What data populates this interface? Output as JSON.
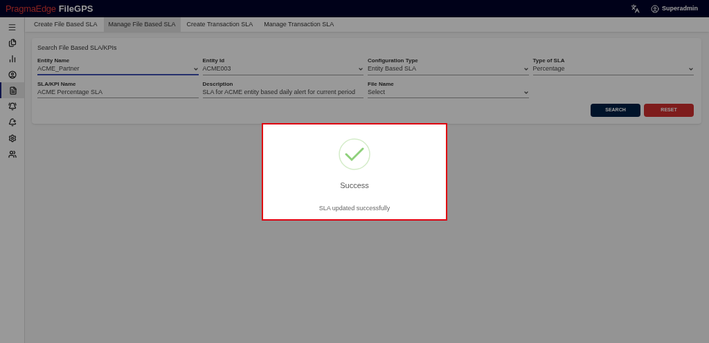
{
  "header": {
    "brand": "PragmaEdge",
    "product": "FileGPS",
    "user": "Superadmin"
  },
  "sidebar": {
    "items": [
      {
        "selected": false
      },
      {
        "selected": false
      },
      {
        "selected": false
      },
      {
        "selected": true
      },
      {
        "selected": false
      },
      {
        "selected": false
      },
      {
        "selected": false
      },
      {
        "selected": false
      }
    ]
  },
  "tabs": [
    {
      "label": "Create File Based SLA",
      "selected": false
    },
    {
      "label": "Manage File Based SLA",
      "selected": true
    },
    {
      "label": "Create Transaction SLA",
      "selected": false
    },
    {
      "label": "Manage Transaction SLA",
      "selected": false
    }
  ],
  "search_card": {
    "title": "Search File Based SLA/KPIs",
    "rows": [
      [
        {
          "label": "Entity Name",
          "value": "ACME_Partner",
          "kind": "select",
          "focused": true
        },
        {
          "label": "Entity Id",
          "value": "ACME003",
          "kind": "select",
          "focused": false
        },
        {
          "label": "Configuration Type",
          "value": "Entity Based SLA",
          "kind": "select",
          "focused": false
        },
        {
          "label": "Type of SLA",
          "value": "Percentage",
          "kind": "select",
          "focused": false
        }
      ],
      [
        {
          "label": "SLA/KPI Name",
          "value": "ACME Percentage SLA",
          "kind": "text",
          "focused": false
        },
        {
          "label": "Description",
          "value": "SLA for ACME entity based daily alert for current period",
          "kind": "text",
          "focused": false
        },
        {
          "label": "File Name",
          "value": "Select",
          "kind": "select",
          "focused": false
        }
      ]
    ],
    "buttons": [
      {
        "label": "SEARCH",
        "kind": "primary"
      },
      {
        "label": "RESET",
        "kind": "danger"
      }
    ]
  },
  "dialog": {
    "title": "Success",
    "message": "SLA updated successfully"
  }
}
